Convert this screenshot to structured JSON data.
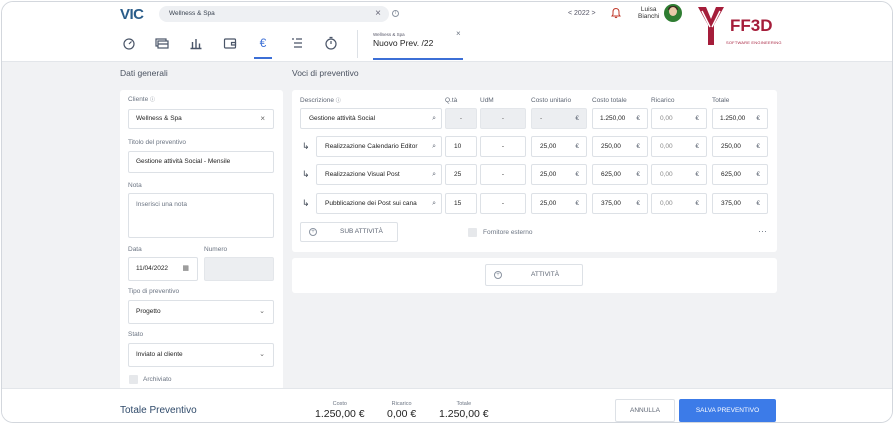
{
  "header": {
    "logo": "VIC",
    "search_value": "Wellness & Spa",
    "year": "< 2022 >",
    "user_first": "Luisa",
    "user_last": "Bianchi",
    "brand": "FF3D",
    "brand_sub": "SOFTWARE ENGINEERING",
    "doc_tab_client": "Wellness & Spa",
    "doc_tab_title": "Nuovo Prev. /22",
    "nav_icons": [
      "dashboard-icon",
      "card-icon",
      "chart-icon",
      "wallet-icon",
      "euro-icon",
      "list-icon",
      "timer-icon"
    ],
    "accent": "#3c6fd6"
  },
  "general": {
    "section_title": "Dati generali",
    "cliente_label": "Cliente",
    "cliente_value": "Wellness & Spa",
    "titolo_label": "Titolo del preventivo",
    "titolo_value": "Gestione attività Social - Mensile",
    "nota_label": "Nota",
    "nota_placeholder": "Inserisci una nota",
    "data_label": "Data",
    "data_value": "11/04/2022",
    "numero_label": "Numero",
    "tipo_label": "Tipo di preventivo",
    "tipo_value": "Progetto",
    "stato_label": "Stato",
    "stato_value": "Inviato al cliente",
    "archiviato_label": "Archiviato"
  },
  "items": {
    "section_title": "Voci di preventivo",
    "headers": {
      "descrizione": "Descrizione",
      "qta": "Q.tà",
      "udm": "UdM",
      "costo_unitario": "Costo unitario",
      "costo_totale": "Costo totale",
      "ricarico": "Ricarico",
      "totale": "Totale"
    },
    "rows": [
      {
        "desc": "Gestione attività Social",
        "qta": "-",
        "udm": "-",
        "cu": "-",
        "ct": "1.250,00",
        "ric": "0,00",
        "tot": "1.250,00"
      },
      {
        "desc": "Realizzazione Calendario Editor",
        "qta": "10",
        "udm": "-",
        "cu": "25,00",
        "ct": "250,00",
        "ric": "0,00",
        "tot": "250,00"
      },
      {
        "desc": "Realizzazione Visual Post",
        "qta": "25",
        "udm": "-",
        "cu": "25,00",
        "ct": "625,00",
        "ric": "0,00",
        "tot": "625,00"
      },
      {
        "desc": "Pubblicazione dei Post sui cana",
        "qta": "15",
        "udm": "-",
        "cu": "25,00",
        "ct": "375,00",
        "ric": "0,00",
        "tot": "375,00"
      }
    ],
    "currency": "€",
    "sub_button": "SUB ATTIVITÀ",
    "fornitore_label": "Fornitore esterno",
    "more": "···",
    "attivita_button": "ATTIVITÀ"
  },
  "footer": {
    "totale_label": "Totale Preventivo",
    "costo_label": "Costo",
    "costo_value": "1.250,00 €",
    "ricarico_label": "Ricarico",
    "ricarico_value": "0,00 €",
    "totale_small_label": "Totale",
    "totale_value": "1.250,00 €",
    "annulla": "ANNULLA",
    "salva": "SALVA PREVENTIVO",
    "primary_color": "#3c7be8"
  }
}
